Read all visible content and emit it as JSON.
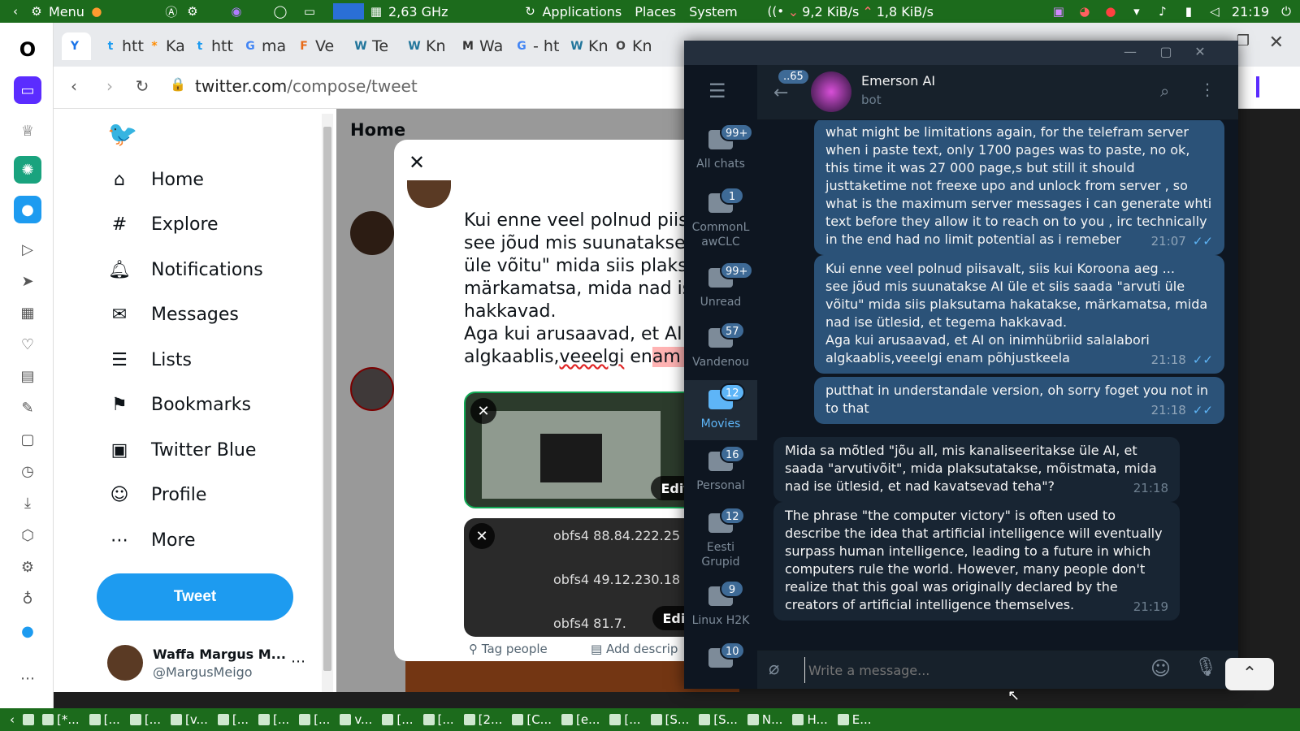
{
  "topbar": {
    "menu_label": "Menu",
    "cpu": "2,63 GHz",
    "applications": "Applications",
    "places": "Places",
    "system": "System",
    "down_speed": "9,2 KiB/s",
    "up_speed": "1,8 KiB/s",
    "clock": "21:19"
  },
  "browser": {
    "tabs": [
      {
        "label": "",
        "icon": "Y"
      },
      {
        "label": "htt",
        "icon": "t"
      },
      {
        "label": "Ka",
        "icon": "*"
      },
      {
        "label": "htt",
        "icon": "t"
      },
      {
        "label": "ma",
        "icon": "G"
      },
      {
        "label": "Ve",
        "icon": "F"
      },
      {
        "label": "Te",
        "icon": "W"
      },
      {
        "label": "Kn",
        "icon": "W"
      },
      {
        "label": "Wa",
        "icon": "M"
      },
      {
        "label": "- ht",
        "icon": "G"
      },
      {
        "label": "Kn",
        "icon": "W"
      },
      {
        "label": "Kn",
        "icon": "O"
      }
    ],
    "url_host": "twitter.com",
    "url_path": "/compose/tweet"
  },
  "twitter": {
    "nav": [
      {
        "label": "Home",
        "icon": "home-icon"
      },
      {
        "label": "Explore",
        "icon": "hashtag-icon"
      },
      {
        "label": "Notifications",
        "icon": "bell-icon"
      },
      {
        "label": "Messages",
        "icon": "mail-icon"
      },
      {
        "label": "Lists",
        "icon": "list-icon"
      },
      {
        "label": "Bookmarks",
        "icon": "bookmark-icon"
      },
      {
        "label": "Twitter Blue",
        "icon": "twitter-blue-icon"
      },
      {
        "label": "Profile",
        "icon": "person-icon"
      },
      {
        "label": "More",
        "icon": "more-icon"
      }
    ],
    "tweet_button": "Tweet",
    "header": "Home",
    "account_name": "Waffa Margus M...",
    "account_handle": "@MargusMeigo",
    "compose": {
      "line1": "Kui enne veel polnud piisa",
      "line2": "see jõud mis suunatakse",
      "line3": "üle võitu\" mida siis plaksu",
      "line4": "märkamatsa, mida nad is",
      "line5": "hakkavad.",
      "line6": "Aga kui arusaavad, et AI o",
      "line7_a": "algkaablis,",
      "line7_b": "veeelgi",
      "line7_c": " en",
      "line7_d": "am p",
      "edit_label": "Edit",
      "media2_rows": [
        "obfs4 88.84.222.25",
        "obfs4 49.12.230.18",
        "obfs4 81.7."
      ],
      "tag_people": "Tag people",
      "add_description": "Add descrip"
    }
  },
  "telegram": {
    "back_badge": "..65",
    "chat_name": "Emerson AI",
    "chat_status": "bot",
    "input_placeholder": "Write a message...",
    "folders": [
      {
        "label": "All chats",
        "badge": "99+"
      },
      {
        "label": "CommonL awCLC",
        "badge": "1"
      },
      {
        "label": "Unread",
        "badge": "99+"
      },
      {
        "label": "Vandenou",
        "badge": "57"
      },
      {
        "label": "Movies",
        "badge": "12"
      },
      {
        "label": "Personal",
        "badge": "16"
      },
      {
        "label": "Eesti Grupid",
        "badge": "12"
      },
      {
        "label": "Linux H2K",
        "badge": "9"
      },
      {
        "label": "",
        "badge": "10"
      }
    ],
    "messages": [
      {
        "dir": "out",
        "text": "what might be limitations again, for the telefram server when i paste text, only 1700 pages was to paste, no ok, this time it was 27 000 page,s but still it should justtaketime not freexe upo and unlock from server , so what is the maximum server messages i can generate whti text before they allow it to reach on to you , irc technically in the end had no limit potential as i remeber",
        "time": "21:07"
      },
      {
        "dir": "out",
        "text": "Kui enne veel polnud piisavalt, siis kui Koroona aeg ...\nsee jõud mis suunatakse AI üle et siis saada \"arvuti üle võitu\" mida siis plaksutama hakatakse, märkamatsa, mida nad ise ütlesid, et tegema hakkavad.\nAga kui arusaavad, et AI on inimhübriid salalabori algkaablis,veeelgi enam põhjustkeela",
        "time": "21:18"
      },
      {
        "dir": "out",
        "text": "putthat in understandale version, oh sorry foget you not in to that",
        "time": "21:18"
      },
      {
        "dir": "in",
        "text": "Mida sa mõtled \"jõu all, mis kanaliseeritakse üle AI, et saada \"arvutivõit\", mida plaksutatakse, mõistmata, mida nad ise ütlesid, et nad kavatsevad teha\"?",
        "time": "21:18"
      },
      {
        "dir": "in",
        "text": "The phrase \"the computer victory\" is often used to describe the idea that artificial intelligence will eventually surpass human intelligence, leading to a future in which computers rule the world. However, many people don't realize that this goal was originally declared by the creators of artificial intelligence themselves.",
        "time": "21:19"
      }
    ]
  },
  "taskbar": {
    "items": [
      "[*...",
      "[...",
      "[...",
      "[v...",
      "[...",
      "[...",
      "[...",
      "v...",
      "[...",
      "[...",
      "[2...",
      "[C...",
      "[e...",
      "[...",
      "[S...",
      "[S...",
      "N...",
      "H...",
      "E..."
    ]
  }
}
